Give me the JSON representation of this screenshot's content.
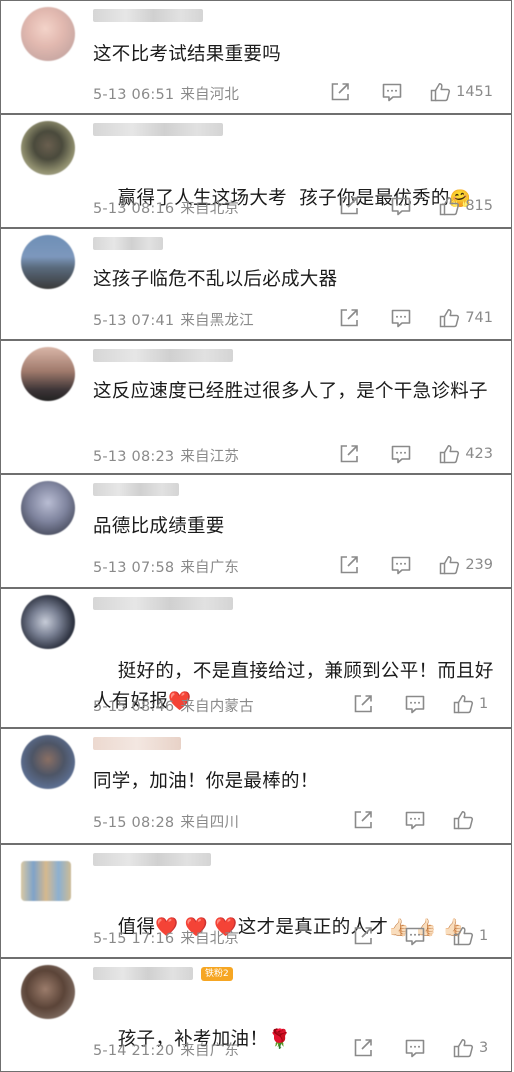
{
  "comments": [
    {
      "text": "这不比考试结果重要吗",
      "date": "5-13 06:51",
      "location": "来自河北",
      "likes": "1451"
    },
    {
      "text": "赢得了人生这场大考  孩子你是最优秀的",
      "emoji": "🤗",
      "date": "5-13 08:16",
      "location": "来自北京",
      "likes": "815"
    },
    {
      "text": "这孩子临危不乱以后必成大器",
      "date": "5-13 07:41",
      "location": "来自黑龙江",
      "likes": "741"
    },
    {
      "text": "这反应速度已经胜过很多人了，是个干急诊料子",
      "date": "5-13 08:23",
      "location": "来自江苏",
      "likes": "423"
    },
    {
      "text": "品德比成绩重要",
      "date": "5-13 07:58",
      "location": "来自广东",
      "likes": "239"
    },
    {
      "text": "挺好的，不是直接给过，兼顾到公平！而且好人有好报",
      "emoji": "❤️",
      "date": "5-15 08:46",
      "location": "来自内蒙古",
      "likes": "1"
    },
    {
      "text": "同学，加油！你是最棒的！",
      "date": "5-15 08:28",
      "location": "来自四川",
      "likes": ""
    },
    {
      "text_before": "值得",
      "text_after": "这才是真正的人才",
      "hearts": "❤️ ❤️ ❤️",
      "thumbs": "👍🏻 👍🏻 👍🏻",
      "date": "5-15 17:16",
      "location": "来自北京",
      "likes": "1"
    },
    {
      "text": "孩子，补考加油！",
      "emoji": "🌹",
      "badge": "铁粉2",
      "date": "5-14 21:20",
      "location": "来自广东",
      "likes": "3"
    }
  ],
  "icons": {
    "share": "share-icon",
    "comment": "comment-icon",
    "like": "thumbs-up-icon"
  },
  "colors": {
    "text": "#1b1b1b",
    "meta": "#8a8a8a",
    "badge": "#f6a623",
    "heart": "#e0303a"
  }
}
